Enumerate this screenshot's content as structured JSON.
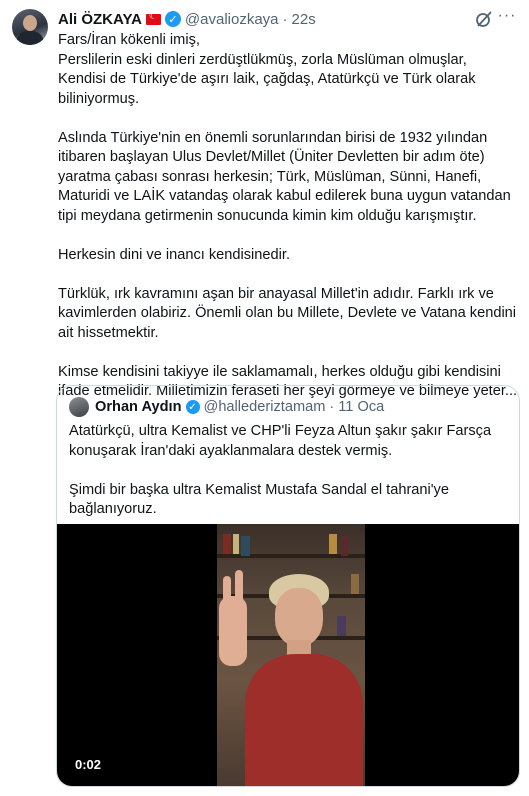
{
  "tweet": {
    "author_name": "Ali ÖZKAYA",
    "handle": "@avaliozkaya",
    "separator": "·",
    "time": "22s",
    "paragraphs": [
      "Fars/İran kökenli imiş,\nPerslilerin eski dinleri zerdüştlükmüş, zorla Müslüman olmuşlar,\nKendisi de Türkiye'de aşırı laik, çağdaş, Atatürkçü ve Türk olarak biliniyormuş.",
      "Aslında Türkiye'nin en önemli sorunlarından birisi de 1932 yılından itibaren başlayan Ulus Devlet/Millet (Üniter Devletten bir adım öte) yaratma çabası sonrası herkesin; Türk, Müslüman, Sünni, Hanefi, Maturidi ve LAİK vatandaş olarak kabul edilerek buna uygun vatandan tipi meydana getirmenin sonucunda kimin kim olduğu karışmıştır.",
      "Herkesin dini ve inancı kendisinedir.",
      "Türklük, ırk kavramını aşan bir anayasal Millet'in adıdır. Farklı ırk ve kavimlerden olabiriz. Önemli olan bu Millete, Devlete ve Vatana kendini ait hissetmektir.",
      "Kimse kendisini takiyye ile saklamamalı, herkes olduğu gibi kendisini ifade etmelidir. Milletimizin feraseti her şeyi görmeye ve bilmeye yeter..."
    ]
  },
  "quote": {
    "author_name": "Orhan Aydın",
    "handle": "@hallederiztamam",
    "separator": "·",
    "date": "11 Oca",
    "paragraphs": [
      "Atatürkçü, ultra Kemalist ve CHP'li Feyza Altun şakır şakır Farsça konuşarak İran'daki ayaklanmalara destek vermiş.",
      "Şimdi bir başka ultra Kemalist Mustafa Sandal el tahrani'ye bağlanıyoruz."
    ],
    "video_time": "0:02"
  },
  "icons": [
    "verified-badge",
    "turkey-flag",
    "grok-icon",
    "more-icon"
  ],
  "colors": {
    "verified": "#1d9bf0",
    "secondary_text": "#536471",
    "border": "#cfd9de"
  }
}
